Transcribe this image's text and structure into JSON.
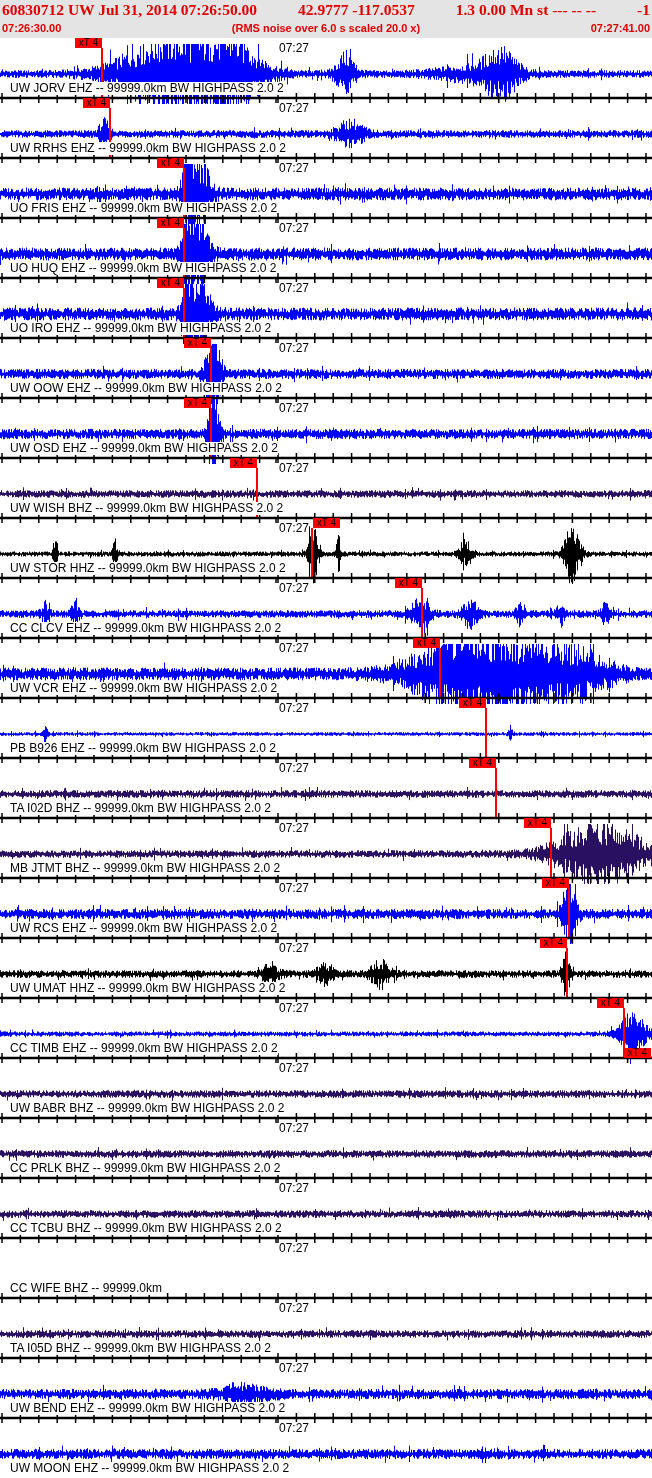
{
  "header": {
    "title_parts": [
      "60830712 UW Jul 31, 2014 07:26:50.00",
      "42.9777 -117.0537",
      "1.3 0.00 Mn st --- -- --",
      "-1"
    ],
    "start_time": "07:26:30.00",
    "note": "(RMS noise over 6.0 s scaled 20.0 x)",
    "end_time": "07:27:41.00"
  },
  "traces": [
    {
      "label": "UW JORV EHZ -- 99999.0km BW HIGHPASS 2.0 2",
      "time": "07:27",
      "color": "#0000ff",
      "picks": [
        {
          "kind": "onset",
          "label": "xT 4"
        }
      ]
    },
    {
      "label": "UW RRHS EHZ -- 99999.0km BW HIGHPASS 2.0 2",
      "time": "07:27",
      "color": "#0000ff",
      "picks": [
        {
          "kind": "onset",
          "label": "xT 4"
        }
      ]
    },
    {
      "label": "UO FRIS EHZ -- 99999.0km BW HIGHPASS 2.0 2",
      "time": "07:27",
      "color": "#0000ff",
      "picks": [
        {
          "kind": "onset",
          "label": "xT 4"
        }
      ]
    },
    {
      "label": "UO HUQ EHZ -- 99999.0km BW HIGHPASS 2.0 2",
      "time": "07:27",
      "color": "#0000ff",
      "picks": [
        {
          "kind": "onset",
          "label": "xT 4"
        }
      ]
    },
    {
      "label": "UO IRO EHZ -- 99999.0km BW HIGHPASS 2.0 2",
      "time": "07:27",
      "color": "#0000ff",
      "picks": [
        {
          "kind": "onset",
          "label": "xT 4"
        }
      ]
    },
    {
      "label": "UW OOW EHZ -- 99999.0km BW HIGHPASS 2.0 2",
      "time": "07:27",
      "color": "#0000ff",
      "picks": [
        {
          "kind": "onset",
          "label": "xT 4"
        }
      ]
    },
    {
      "label": "UW OSD EHZ -- 99999.0km BW HIGHPASS 2.0 2",
      "time": "07:27",
      "color": "#0000ff",
      "picks": [
        {
          "kind": "onset",
          "label": "xT 4"
        }
      ]
    },
    {
      "label": "UW WISH BHZ -- 99999.0km BW HIGHPASS 2.0 2",
      "time": "07:27",
      "color": "#2a1060",
      "picks": [
        {
          "kind": "onset",
          "label": "xT 4"
        }
      ]
    },
    {
      "label": "UW STOR HHZ -- 99999.0km BW HIGHPASS 2.0 2",
      "time": "07:27",
      "color": "#000000",
      "picks": [
        {
          "kind": "onset",
          "label": "xT 4"
        }
      ]
    },
    {
      "label": "CC CLCV EHZ -- 99999.0km BW HIGHPASS 2.0 2",
      "time": "07:27",
      "color": "#0000ff",
      "picks": [
        {
          "kind": "onset",
          "label": "xT 4"
        }
      ]
    },
    {
      "label": "UW VCR EHZ -- 99999.0km BW HIGHPASS 2.0 2",
      "time": "07:27",
      "color": "#0000ff",
      "picks": [
        {
          "kind": "onset",
          "label": "xT 4"
        }
      ]
    },
    {
      "label": "PB B926 EHZ -- 99999.0km BW HIGHPASS 2.0 2",
      "time": "07:27",
      "color": "#0000ff",
      "picks": [
        {
          "kind": "onset",
          "label": "xT 4"
        }
      ]
    },
    {
      "label": "TA I02D BHZ -- 99999.0km BW HIGHPASS 2.0 2",
      "time": "07:27",
      "color": "#2a1060",
      "picks": [
        {
          "kind": "onset",
          "label": "xT 4"
        }
      ]
    },
    {
      "label": "MB JTMT BHZ -- 99999.0km BW HIGHPASS 2.0 2",
      "time": "07:27",
      "color": "#2a1060",
      "picks": [
        {
          "kind": "onset",
          "label": "xT 4"
        }
      ]
    },
    {
      "label": "UW RCS EHZ -- 99999.0km BW HIGHPASS 2.0 2",
      "time": "07:27",
      "color": "#0000ff",
      "picks": [
        {
          "kind": "onset",
          "label": "xT 4"
        }
      ]
    },
    {
      "label": "UW UMAT HHZ -- 99999.0km BW HIGHPASS 2.0 2",
      "time": "07:27",
      "color": "#000000",
      "picks": [
        {
          "kind": "onset",
          "label": "xT 4"
        }
      ]
    },
    {
      "label": "CC TIMB EHZ -- 99999.0km BW HIGHPASS 2.0 2",
      "time": "07:27",
      "color": "#0000ff",
      "picks": [
        {
          "kind": "onset",
          "label": "xT 4"
        },
        {
          "kind": "end",
          "label": "xT 4"
        }
      ]
    },
    {
      "label": "UW BABR BHZ -- 99999.0km BW HIGHPASS 2.0 2",
      "time": "07:27",
      "color": "#2a1060"
    },
    {
      "label": "CC PRLK BHZ -- 99999.0km BW HIGHPASS 2.0 2",
      "time": "07:27",
      "color": "#2a1060"
    },
    {
      "label": "CC TCBU BHZ -- 99999.0km BW HIGHPASS 2.0 2",
      "time": "07:27",
      "color": "#2a1060"
    },
    {
      "label": "CC WIFE BHZ -- 99999.0km",
      "time": "07:27"
    },
    {
      "label": "TA I05D BHZ -- 99999.0km BW HIGHPASS 2.0 2",
      "time": "07:27",
      "color": "#2a1060"
    },
    {
      "label": "UW BEND EHZ -- 99999.0km BW HIGHPASS 2.0 2",
      "time": "07:27",
      "color": "#0000ff"
    },
    {
      "label": "UW MOON EHZ -- 99999.0km BW HIGHPASS 2.0 2",
      "time": "07:27",
      "color": "#0000ff"
    }
  ]
}
